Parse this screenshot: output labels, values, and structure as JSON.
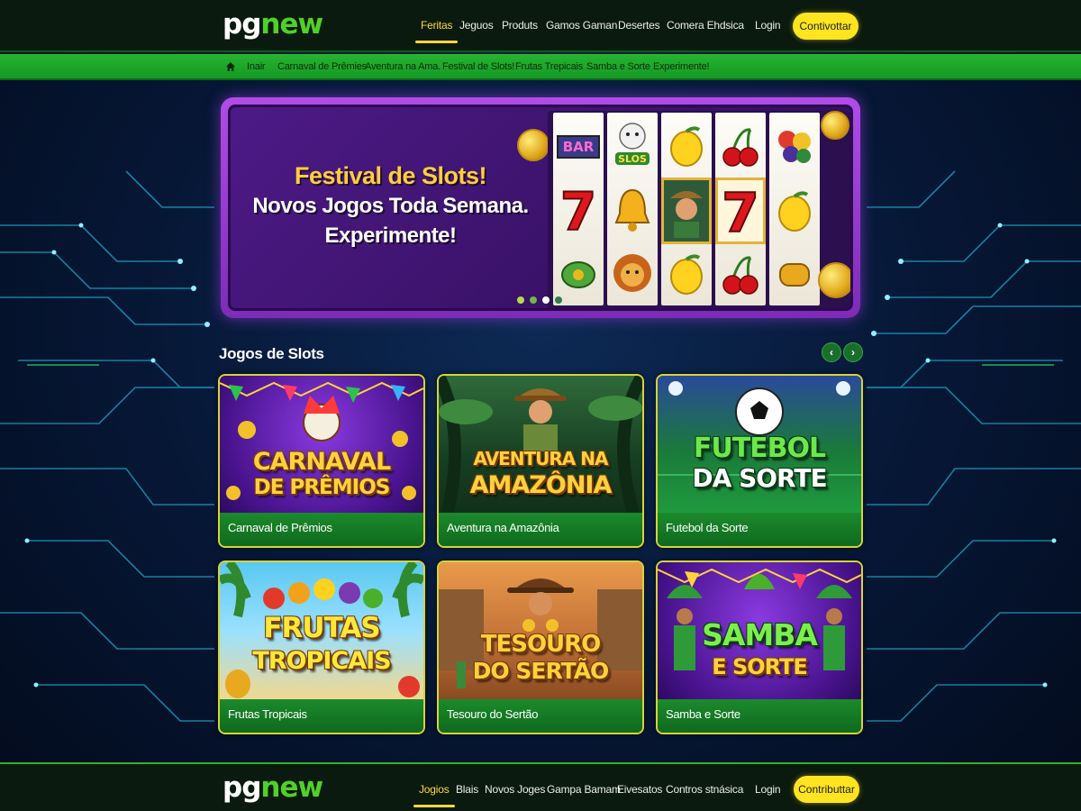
{
  "brand": {
    "prefix": "pg",
    "suffix": "new"
  },
  "header": {
    "nav": [
      "Feritas",
      "Jeguos",
      "Produts",
      "Gamos Gaman",
      "Desertes",
      "Comera Ehdsica"
    ],
    "active_index": 0,
    "login": "Login",
    "cta": "Contivottar"
  },
  "subnav": {
    "home_icon": "home-icon",
    "items": [
      "Inair",
      "Carnaval de Prêmies",
      "Aventura na Ama.",
      "Festival de Slots!",
      "Frutas Trepicais",
      "Samba e Sorte",
      "Experimente!"
    ]
  },
  "hero": {
    "title": "Festival de Slots!",
    "line1": "Novos Jogos Toda Semana.",
    "line2": "Experimente!",
    "reel_symbols": [
      [
        "BAR",
        "7",
        "leaf"
      ],
      [
        "SLOS",
        "bell",
        "lion"
      ],
      [
        "lemon",
        "hero",
        "lemon"
      ],
      [
        "cherry",
        "7",
        "cherry"
      ],
      [
        "fruits",
        "lemon",
        "coin"
      ]
    ],
    "carousel_dots": 4,
    "active_dot": 2
  },
  "section": {
    "title": "Jogos de Slots",
    "prev_icon": "chevron-left-icon",
    "next_icon": "chevron-right-icon"
  },
  "games": [
    {
      "label": "Carnaval de Prêmios",
      "art_line1": "CARNAVAL",
      "art_line2": "DE PRÊMIOS"
    },
    {
      "label": "Aventura na Amazônia",
      "art_line1": "AVENTURA NA",
      "art_line2": "AMAZÔNIA"
    },
    {
      "label": "Futebol da Sorte",
      "art_line1": "FUTEBOL",
      "art_line2": "DA SORTE"
    },
    {
      "label": "Frutas Tropicais",
      "art_line1": "FRUTAS",
      "art_line2": "TROPICAIS"
    },
    {
      "label": "Tesouro do Sertão",
      "art_line1": "TESOURO",
      "art_line2": "DO SERTÃO"
    },
    {
      "label": "Samba e Sorte",
      "art_line1": "SAMBA",
      "art_line2": "E SORTE"
    }
  ],
  "footer": {
    "nav": [
      "Jogios",
      "Blais",
      "Novos Joges",
      "Gampa Bamam",
      "Eivesatos",
      "Contros stnásica"
    ],
    "active_index": 0,
    "login": "Login",
    "cta": "Contributtar"
  },
  "colors": {
    "accent_yellow": "#ffe51f",
    "brand_green": "#4fd12a",
    "subnav_green": "#26b52f",
    "hero_purple": "#b24be8",
    "background_navy": "#061634"
  }
}
